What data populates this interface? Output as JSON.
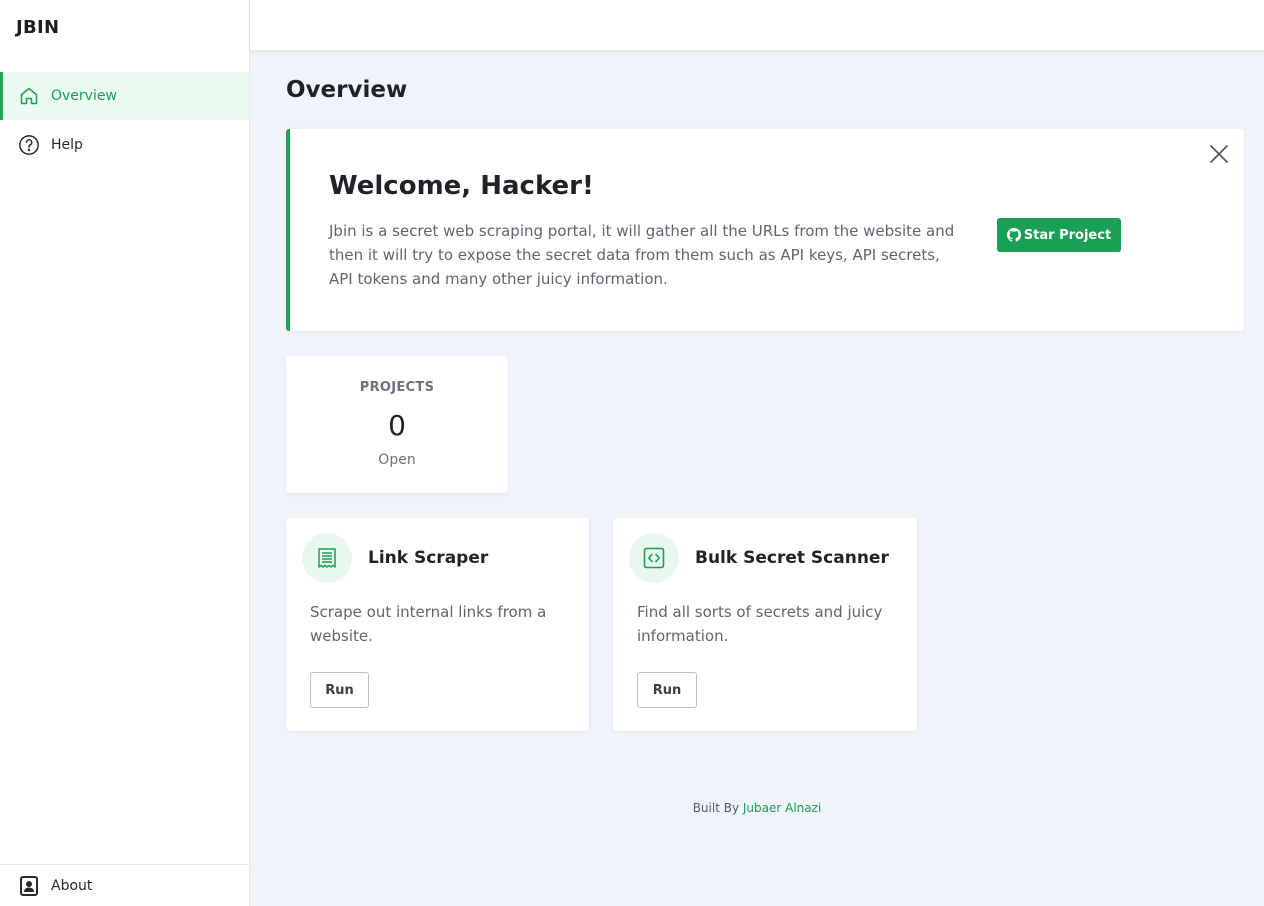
{
  "brand": "JBIN",
  "sidebar": {
    "items": [
      {
        "label": "Overview",
        "icon": "home-icon",
        "active": true
      },
      {
        "label": "Help",
        "icon": "help-circle-icon",
        "active": false
      }
    ],
    "bottom": {
      "label": "About",
      "icon": "contact-card-icon"
    }
  },
  "page_title": "Overview",
  "welcome": {
    "title": "Welcome, Hacker!",
    "text": "Jbin is a secret web scraping portal, it will gather all the URLs from the website and then it will try to expose the secret data from them such as API keys, API secrets, API tokens and many other juicy information.",
    "button_label": "Star Project",
    "button_icon": "github-icon",
    "close_icon": "close-icon"
  },
  "stats": {
    "label": "PROJECTS",
    "value": "0",
    "sub": "Open"
  },
  "tools": [
    {
      "title": "Link Scraper",
      "description": "Scrape out internal links from a website.",
      "button_label": "Run",
      "icon": "document-list-icon"
    },
    {
      "title": "Bulk Secret Scanner",
      "description": "Find all sorts of secrets and juicy information.",
      "button_label": "Run",
      "icon": "code-icon"
    }
  ],
  "footer": {
    "prefix": "Built By",
    "author": "Jubaer Alnazi"
  },
  "colors": {
    "accent": "#1a9f56",
    "background": "#f1f3fb",
    "active_nav_bg": "#ecfbf2"
  }
}
